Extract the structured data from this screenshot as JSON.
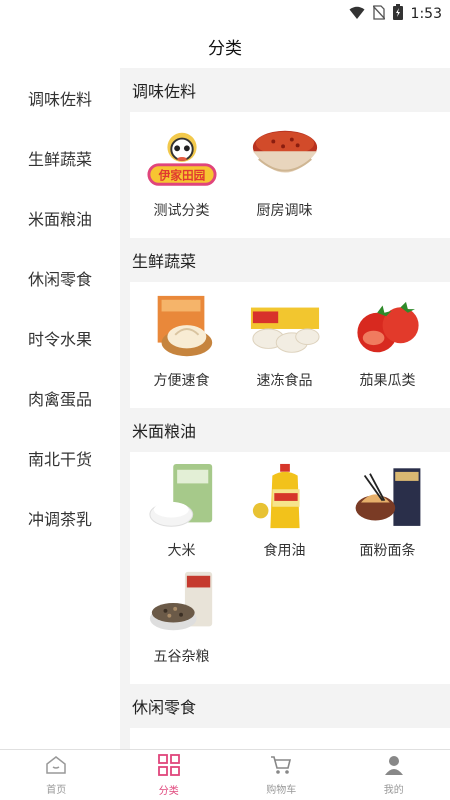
{
  "status_bar": {
    "time": "1:53"
  },
  "header": {
    "title": "分类"
  },
  "sidebar": {
    "items": [
      {
        "label": "调味佐料"
      },
      {
        "label": "生鲜蔬菜"
      },
      {
        "label": "米面粮油"
      },
      {
        "label": "休闲零食"
      },
      {
        "label": "时令水果"
      },
      {
        "label": "肉禽蛋品"
      },
      {
        "label": "南北干货"
      },
      {
        "label": "冲调茶乳"
      }
    ]
  },
  "sections": [
    {
      "title": "调味佐料",
      "items": [
        {
          "label": "测试分类",
          "icon": "yijia-logo-icon"
        },
        {
          "label": "厨房调味",
          "icon": "chili-bowl-icon"
        }
      ]
    },
    {
      "title": "生鲜蔬菜",
      "items": [
        {
          "label": "方便速食",
          "icon": "buns-icon"
        },
        {
          "label": "速冻食品",
          "icon": "dumplings-icon"
        },
        {
          "label": "茄果瓜类",
          "icon": "tomato-icon"
        }
      ]
    },
    {
      "title": "米面粮油",
      "items": [
        {
          "label": "大米",
          "icon": "rice-icon"
        },
        {
          "label": "食用油",
          "icon": "oil-bottle-icon"
        },
        {
          "label": "面粉面条",
          "icon": "noodles-icon"
        },
        {
          "label": "五谷杂粮",
          "icon": "grains-icon"
        }
      ]
    },
    {
      "title": "休闲零食",
      "items": []
    }
  ],
  "tabbar": {
    "tabs": [
      {
        "label": "首页"
      },
      {
        "label": "分类"
      },
      {
        "label": "购物车"
      },
      {
        "label": "我的"
      }
    ]
  },
  "colors": {
    "accent": "#e0457b",
    "content_bg": "#f3f3f3"
  }
}
